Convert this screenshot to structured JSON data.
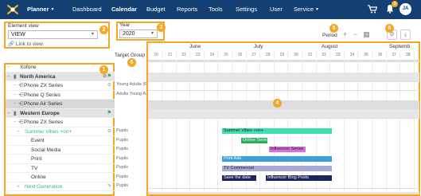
{
  "nav": {
    "items": [
      {
        "label": "Planner",
        "caret": true,
        "active": true
      },
      {
        "label": "Dashboard"
      },
      {
        "label": "Calendar",
        "active": true
      },
      {
        "label": "Budget"
      },
      {
        "label": "Reports"
      },
      {
        "label": "Tools"
      },
      {
        "label": "Settings"
      },
      {
        "label": "User"
      },
      {
        "label": "Service",
        "caret": true
      }
    ],
    "notification_count": "3",
    "avatar_initials": "JA",
    "colors": {
      "bar": "#133f73",
      "accent": "#f5a623"
    }
  },
  "markers": [
    "1",
    "2",
    "3",
    "4",
    "5",
    "6",
    "6"
  ],
  "element_view": {
    "label": "Element view",
    "value": "VIEW",
    "link": "Link to view"
  },
  "year": {
    "label": "Year",
    "value": "2020"
  },
  "period": {
    "label": "Period"
  },
  "target_group_header": "Target Group",
  "tree": [
    {
      "label": "Xofone",
      "level": 0
    },
    {
      "label": "North America",
      "level": 1,
      "bold": true,
      "grey": true
    },
    {
      "label": "Phone ZX Series",
      "level": 2
    },
    {
      "label": "Phone Q Series",
      "level": 2
    },
    {
      "label": "Phone Air Series",
      "level": 2,
      "selected": true
    },
    {
      "label": "Western Europe",
      "level": 1,
      "bold": true,
      "grey": true
    },
    {
      "label": "Phone ZX Series",
      "level": 2
    },
    {
      "label": "Summer Vibes +on+",
      "level": 3,
      "green": true
    },
    {
      "label": "Event",
      "level": 4
    },
    {
      "label": "Social Media",
      "level": 4
    },
    {
      "label": "Print",
      "level": 4
    },
    {
      "label": "TV",
      "level": 4
    },
    {
      "label": "Online",
      "level": 4
    },
    {
      "label": "Next Generation",
      "level": 3,
      "green": true
    }
  ],
  "target_groups": [
    "Young Adults (P...",
    "Adults Young A...",
    "Pupils",
    "Pupils",
    "Pupils",
    "Pupils",
    "Pupils",
    "Pupils",
    "Pupils"
  ],
  "gantt": {
    "months": [
      "June",
      "July",
      "August",
      "Septemb"
    ],
    "weeks": [
      "20",
      "21",
      "22",
      "23",
      "24",
      "25",
      "26",
      "27",
      "28",
      "29",
      "30",
      "31",
      "32",
      "33",
      "34",
      "35",
      "36",
      "37",
      "38"
    ],
    "bars": [
      {
        "label": "Summer Vibes +on+",
        "color": "#3ee0b0",
        "text_color": "#222"
      },
      {
        "label": "Online Series",
        "color": "#27ae60",
        "text_color": "#fff"
      },
      {
        "label": "Influencer Series",
        "color": "#d86ee0",
        "text_color": "#222"
      },
      {
        "label": "Print Ads",
        "color": "#3aa0d8",
        "text_color": "#fff"
      },
      {
        "label": "TV Commercial",
        "color": "#a9a9d6",
        "text_color": "#222"
      },
      {
        "label": "Save the date",
        "color": "#1d2757",
        "text_color": "#fff"
      },
      {
        "label": "Influencer Blog Posts",
        "color": "#1d2757",
        "text_color": "#fff"
      }
    ]
  }
}
